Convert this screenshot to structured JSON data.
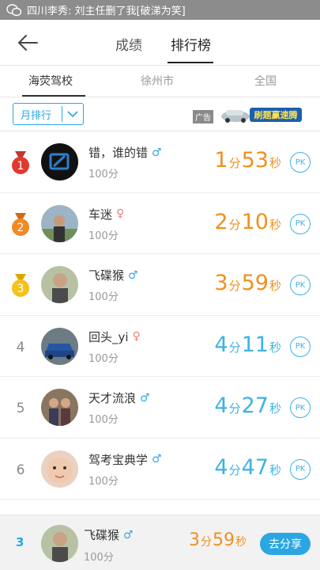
{
  "notification": {
    "text": "四川李秀: 刘主任删了我[破涕为笑]"
  },
  "header": {
    "tab_scores": "成绩",
    "tab_ranking": "排行榜"
  },
  "subtabs": [
    "海荧驾校",
    "徐州市",
    "全国"
  ],
  "filter": {
    "period": "月排行",
    "ad_label": "广告",
    "ad_banner_text": "刷题赢速腾"
  },
  "colors": {
    "accent": "#2aa7e2",
    "top_time": "#f0901e",
    "other_time": "#3cb3e4",
    "male": "#3aa6dc",
    "female": "#f08080"
  },
  "rows": [
    {
      "rank": "1",
      "medal": "gold-red",
      "name": "错，谁的错",
      "gender": "♂",
      "score": "100分",
      "min": "1",
      "min_unit": "分",
      "sec": "53",
      "sec_unit": "秒",
      "pk": "PK"
    },
    {
      "rank": "2",
      "medal": "orange",
      "name": "车迷",
      "gender": "♀",
      "score": "100分",
      "min": "2",
      "min_unit": "分",
      "sec": "10",
      "sec_unit": "秒",
      "pk": "PK"
    },
    {
      "rank": "3",
      "medal": "yellow",
      "name": "飞碟猴",
      "gender": "♂",
      "score": "100分",
      "min": "3",
      "min_unit": "分",
      "sec": "59",
      "sec_unit": "秒",
      "pk": "PK"
    },
    {
      "rank": "4",
      "name": "回头_yi",
      "gender": "♀",
      "score": "100分",
      "min": "4",
      "min_unit": "分",
      "sec": "11",
      "sec_unit": "秒",
      "pk": "PK"
    },
    {
      "rank": "5",
      "name": "天才流浪",
      "gender": "♂",
      "score": "100分",
      "min": "4",
      "min_unit": "分",
      "sec": "27",
      "sec_unit": "秒",
      "pk": "PK"
    },
    {
      "rank": "6",
      "name": "驾考宝典学",
      "gender": "♂",
      "score": "100分",
      "min": "4",
      "min_unit": "分",
      "sec": "47",
      "sec_unit": "秒",
      "pk": "PK"
    }
  ],
  "me": {
    "rank": "3",
    "name": "飞碟猴",
    "gender": "♂",
    "score": "100分",
    "min": "3",
    "min_unit": "分",
    "sec": "59",
    "sec_unit": "秒",
    "share": "去分享"
  }
}
